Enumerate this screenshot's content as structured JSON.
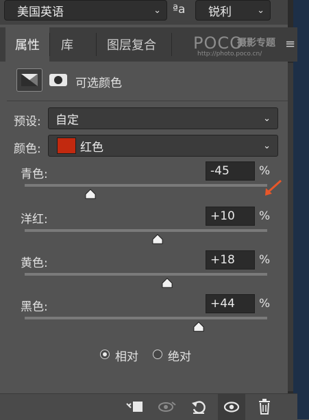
{
  "toolbar": {
    "font_select": "美国英语",
    "aa_icon": "ªa",
    "aa_label": "锐利"
  },
  "tabs": [
    {
      "label": "属性",
      "active": true
    },
    {
      "label": "库",
      "active": false
    },
    {
      "label": "图层复合",
      "active": false
    }
  ],
  "watermark": {
    "brand": "POCO",
    "brand_cn": "摄影专题",
    "url": "http://photo.poco.cn/"
  },
  "panel": {
    "title": "可选颜色",
    "preset_label": "预设:",
    "preset_value": "自定",
    "color_label": "颜色:",
    "color_value": "红色",
    "color_swatch": "#c2290f"
  },
  "sliders": [
    {
      "name": "青色:",
      "value": "-45",
      "unit": "%",
      "level": -45
    },
    {
      "name": "洋红:",
      "value": "+10",
      "unit": "%",
      "level": 10
    },
    {
      "name": "黄色:",
      "value": "+18",
      "unit": "%",
      "level": 18
    },
    {
      "name": "黑色:",
      "value": "+44",
      "unit": "%",
      "level": 44
    }
  ],
  "method": {
    "relative": "相对",
    "absolute": "绝对",
    "selected": "relative"
  },
  "colors": {
    "arrow": "#e8572a",
    "accent_red": "#c2290f"
  }
}
